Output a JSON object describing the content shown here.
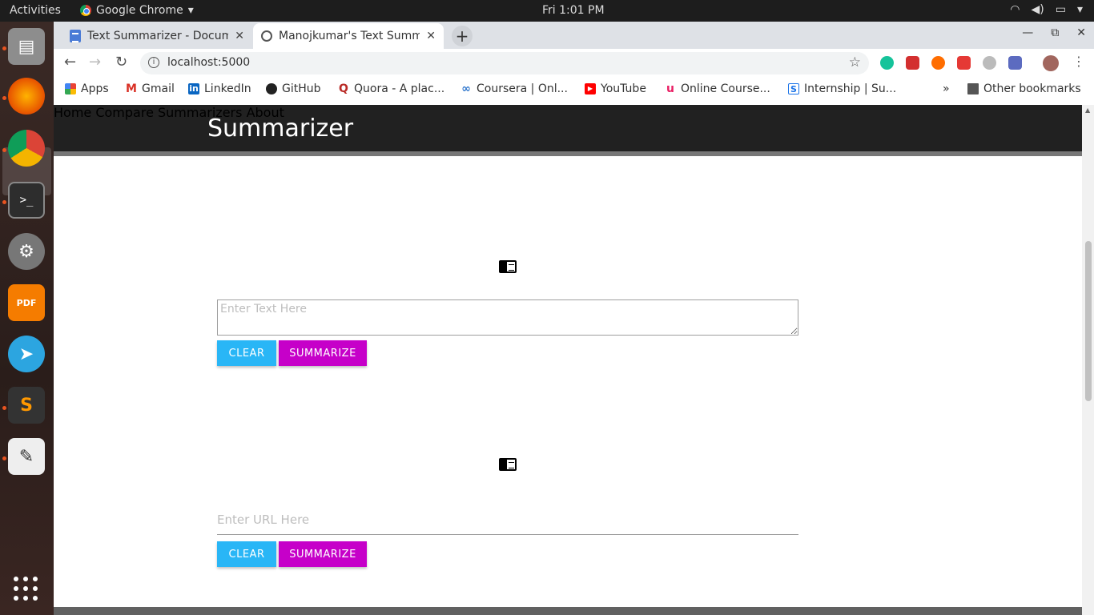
{
  "desktop": {
    "activities": "Activities",
    "app_name": "Google Chrome",
    "clock": "Fri  1:01 PM"
  },
  "browser": {
    "tabs": [
      {
        "title": "Text Summarizer - Docum"
      },
      {
        "title": "Manojkumar's Text Summ"
      }
    ],
    "url": "localhost:5000",
    "bookmarks": [
      {
        "label": "Apps"
      },
      {
        "label": "Gmail"
      },
      {
        "label": "LinkedIn"
      },
      {
        "label": "GitHub"
      },
      {
        "label": "Quora - A plac..."
      },
      {
        "label": "Coursera | Onl..."
      },
      {
        "label": "YouTube"
      },
      {
        "label": "Online Course..."
      },
      {
        "label": "Internship | Su..."
      },
      {
        "label": "Other bookmarks"
      }
    ],
    "overflow": "»"
  },
  "site": {
    "brand": "Summarizer",
    "nav": {
      "home": "Home",
      "compare": "Compare Summarizers",
      "about": "About"
    },
    "text_section": {
      "placeholder": "Enter Text Here",
      "clear_label": "Clear",
      "summarize_label": "Summarize"
    },
    "url_section": {
      "placeholder": "Enter URL Here",
      "clear_label": "Clear",
      "summarize_label": "Summarize"
    }
  },
  "colors": {
    "clear_button": "#29b6f6",
    "summarize_button": "#c600c9",
    "navbar": "#212121"
  }
}
